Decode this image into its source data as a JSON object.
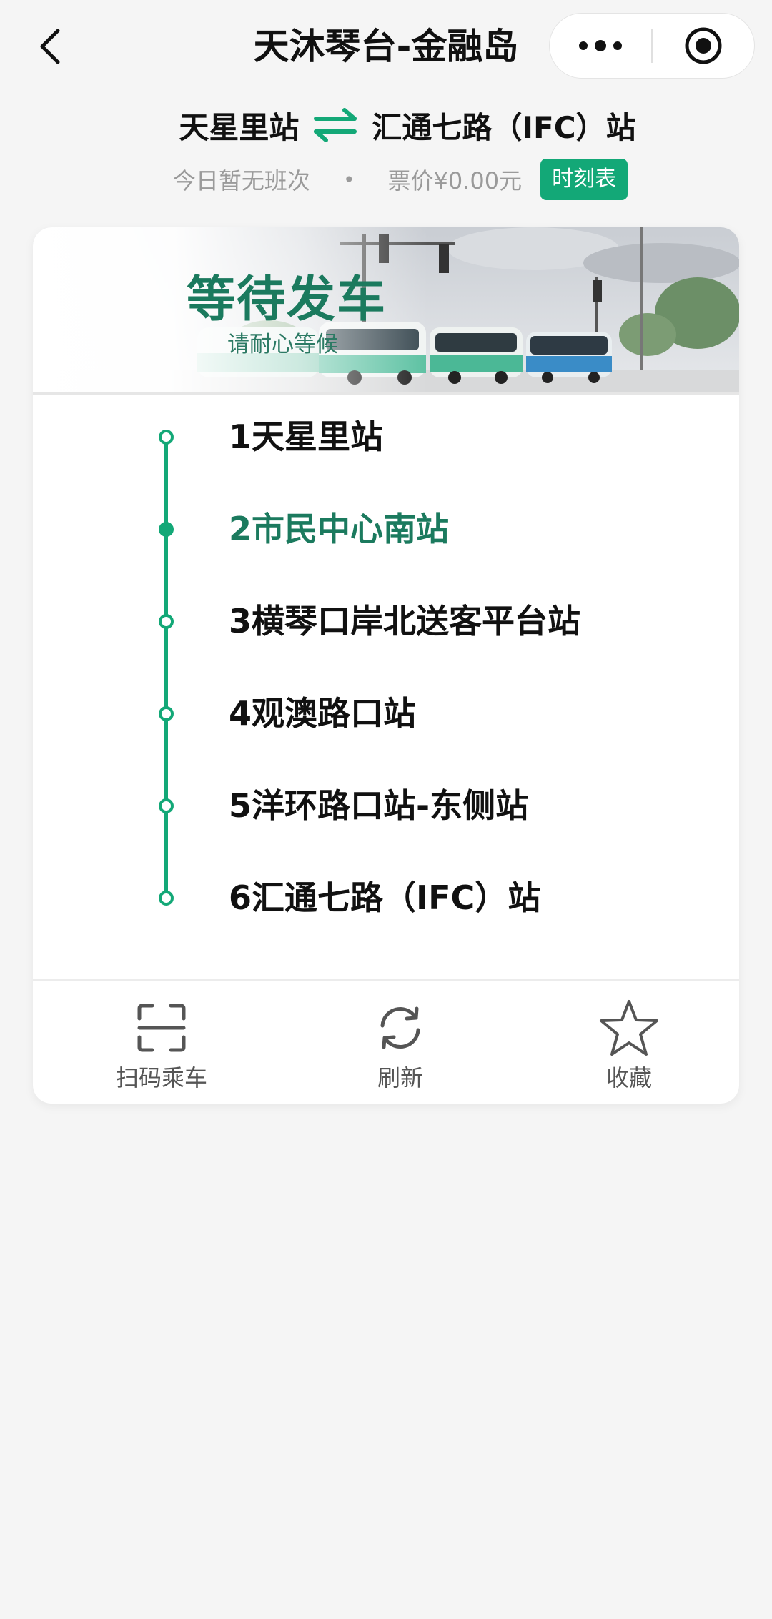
{
  "navbar": {
    "title": "天沐琴台-金融岛",
    "icons": {
      "back": "back-chevron-icon",
      "more": "more-dots-icon",
      "close": "target-close-icon"
    }
  },
  "route": {
    "from": "天星里站",
    "to": "汇通七路（IFC）站",
    "swap_icon": "swap-direction-icon",
    "status": "今日暂无班次",
    "separator": "•",
    "fare": "票价¥0.00元",
    "timetable_label": "时刻表"
  },
  "banner": {
    "title": "等待发车",
    "subtitle": "请耐心等候"
  },
  "stops": [
    {
      "label": "1天星里站",
      "current": false
    },
    {
      "label": "2市民中心南站",
      "current": true
    },
    {
      "label": "3横琴口岸北送客平台站",
      "current": false
    },
    {
      "label": "4观澳路口站",
      "current": false
    },
    {
      "label": "5洋环路口站-东侧站",
      "current": false
    },
    {
      "label": "6汇通七路（IFC）站",
      "current": false
    }
  ],
  "actions": {
    "scan": {
      "label": "扫码乘车",
      "icon": "scan-icon"
    },
    "refresh": {
      "label": "刷新",
      "icon": "refresh-icon"
    },
    "favorite": {
      "label": "收藏",
      "icon": "star-icon"
    }
  },
  "colors": {
    "accent": "#13a877",
    "accent_dark": "#1b7a5e",
    "background": "#f5f5f5",
    "muted_text": "#9a9a9a"
  }
}
